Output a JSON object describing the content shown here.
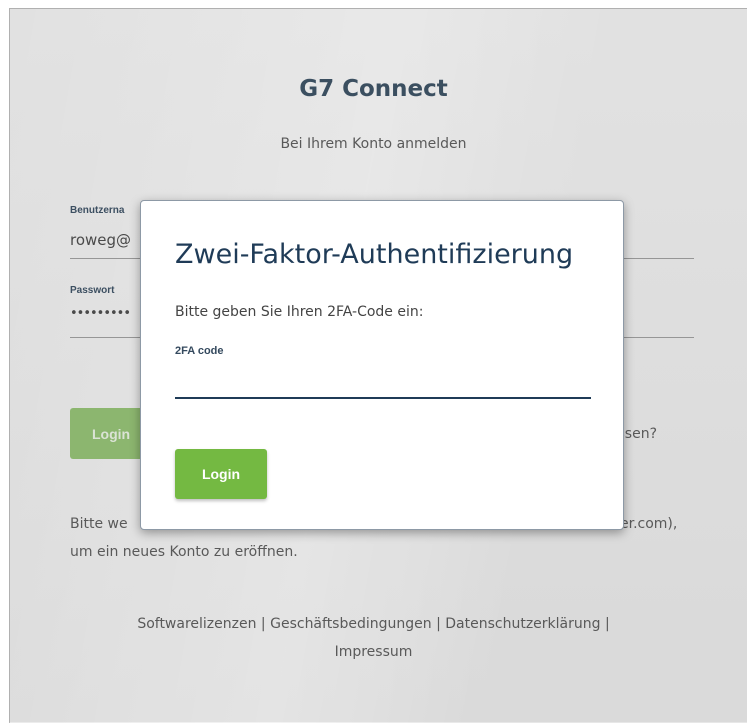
{
  "login_page": {
    "app_title": "G7 Connect",
    "subtitle": "Bei Ihrem Konto anmelden",
    "username_label": "Benutzerna",
    "username_value": "roweg@",
    "password_label": "Passwort",
    "password_value": "•••••••••",
    "login_button": "Login",
    "forgot_link": "gessen?",
    "info_line1_start": "Bitte we",
    "info_line1_end": "er.com),",
    "info_line2": "um ein neues Konto zu eröffnen."
  },
  "footer": {
    "links": [
      "Softwarelizenzen",
      "Geschäftsbedingungen",
      "Datenschutzerklärung",
      "Impressum"
    ],
    "separator": " | "
  },
  "modal": {
    "title": "Zwei-Faktor-Authentifizierung",
    "prompt": "Bitte geben Sie Ihren 2FA-Code ein:",
    "field_label": "2FA code",
    "field_value": "",
    "login_button": "Login"
  }
}
